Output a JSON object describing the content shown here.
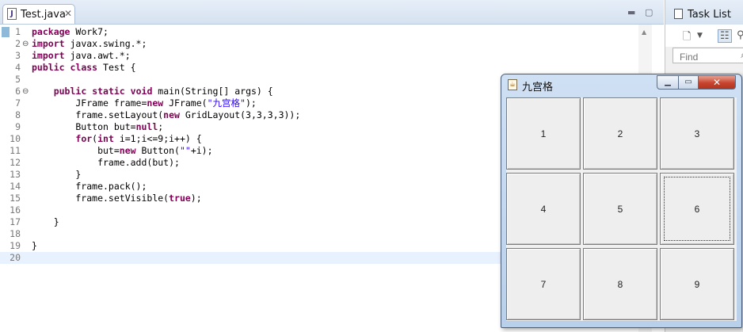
{
  "editor": {
    "tab_label": "Test.java",
    "tab_icon": "java-file-icon",
    "lines": [
      {
        "num": "1",
        "fold": "",
        "parts": [
          [
            "kw",
            "package"
          ],
          [
            "t",
            " Work7;"
          ]
        ]
      },
      {
        "num": "2",
        "fold": "⊖",
        "parts": [
          [
            "kw",
            "import"
          ],
          [
            "t",
            " javax.swing.*;"
          ]
        ]
      },
      {
        "num": "3",
        "fold": "",
        "parts": [
          [
            "kw",
            "import"
          ],
          [
            "t",
            " java.awt.*;"
          ]
        ]
      },
      {
        "num": "4",
        "fold": "",
        "parts": [
          [
            "kw",
            "public"
          ],
          [
            "t",
            " "
          ],
          [
            "kw",
            "class"
          ],
          [
            "t",
            " Test {"
          ]
        ]
      },
      {
        "num": "5",
        "fold": "",
        "parts": []
      },
      {
        "num": "6",
        "fold": "⊖",
        "parts": [
          [
            "t",
            "    "
          ],
          [
            "kw",
            "public"
          ],
          [
            "t",
            " "
          ],
          [
            "kw",
            "static"
          ],
          [
            "t",
            " "
          ],
          [
            "kw",
            "void"
          ],
          [
            "t",
            " main(String[] args) {"
          ]
        ]
      },
      {
        "num": "7",
        "fold": "",
        "parts": [
          [
            "t",
            "        JFrame frame="
          ],
          [
            "kw",
            "new"
          ],
          [
            "t",
            " JFrame("
          ],
          [
            "str",
            "\"九宫格\""
          ],
          [
            "t",
            ");"
          ]
        ]
      },
      {
        "num": "8",
        "fold": "",
        "parts": [
          [
            "t",
            "        frame.setLayout("
          ],
          [
            "kw",
            "new"
          ],
          [
            "t",
            " GridLayout(3,3,3,3));"
          ]
        ]
      },
      {
        "num": "9",
        "fold": "",
        "parts": [
          [
            "t",
            "        Button but="
          ],
          [
            "kw",
            "null"
          ],
          [
            "t",
            ";"
          ]
        ]
      },
      {
        "num": "10",
        "fold": "",
        "parts": [
          [
            "t",
            "        "
          ],
          [
            "kw",
            "for"
          ],
          [
            "t",
            "("
          ],
          [
            "kw",
            "int"
          ],
          [
            "t",
            " i=1;i<=9;i++) {"
          ]
        ]
      },
      {
        "num": "11",
        "fold": "",
        "parts": [
          [
            "t",
            "            but="
          ],
          [
            "kw",
            "new"
          ],
          [
            "t",
            " Button("
          ],
          [
            "str",
            "\"\""
          ],
          [
            "t",
            "+i);"
          ]
        ]
      },
      {
        "num": "12",
        "fold": "",
        "parts": [
          [
            "t",
            "            frame.add(but);"
          ]
        ]
      },
      {
        "num": "13",
        "fold": "",
        "parts": [
          [
            "t",
            "        }"
          ]
        ]
      },
      {
        "num": "14",
        "fold": "",
        "parts": [
          [
            "t",
            "        frame.pack();"
          ]
        ]
      },
      {
        "num": "15",
        "fold": "",
        "parts": [
          [
            "t",
            "        frame.setVisible("
          ],
          [
            "kw",
            "true"
          ],
          [
            "t",
            ");"
          ]
        ]
      },
      {
        "num": "16",
        "fold": "",
        "parts": []
      },
      {
        "num": "17",
        "fold": "",
        "parts": [
          [
            "t",
            "    }"
          ]
        ]
      },
      {
        "num": "18",
        "fold": "",
        "parts": []
      },
      {
        "num": "19",
        "fold": "",
        "parts": [
          [
            "t",
            "}"
          ]
        ]
      },
      {
        "num": "20",
        "fold": "",
        "parts": []
      }
    ],
    "current_line": "20"
  },
  "task_list": {
    "title": "Task List",
    "find_placeholder": "Find"
  },
  "swing_window": {
    "title": "九宫格",
    "buttons": [
      "1",
      "2",
      "3",
      "4",
      "5",
      "6",
      "7",
      "8",
      "9"
    ],
    "focused_button": "6"
  },
  "colors": {
    "keyword": "#7f0055",
    "string": "#2a00ff",
    "current_line": "#e8f2fe"
  }
}
